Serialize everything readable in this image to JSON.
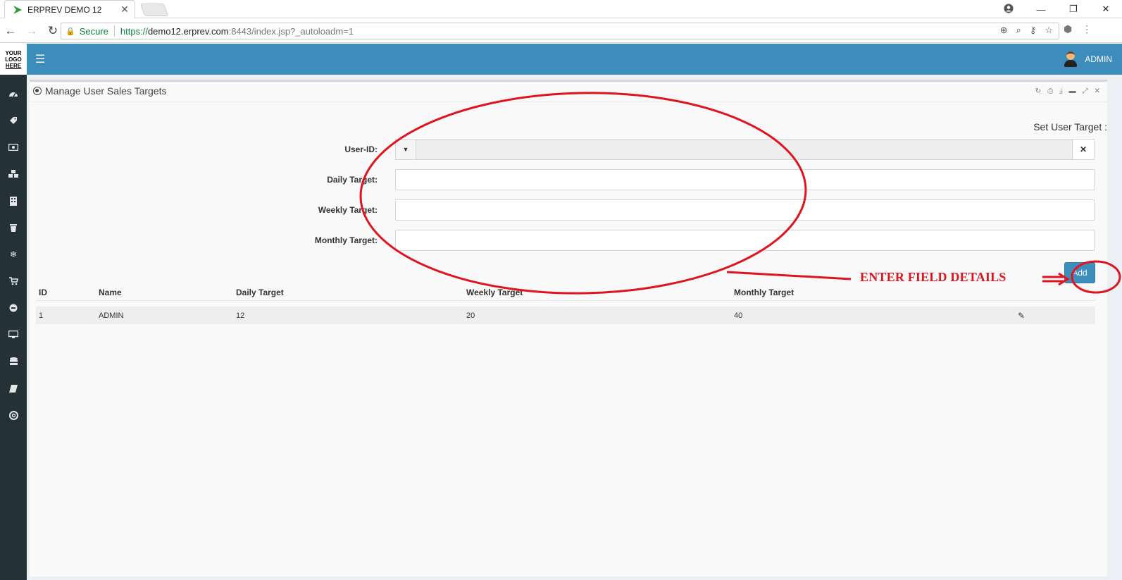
{
  "browser": {
    "tab_title": "ERPREV DEMO 12",
    "tab_close": "✕",
    "secure_label": "Secure",
    "url_scheme": "https://",
    "url_host": "demo12.erprev.com",
    "url_path": ":8443/index.jsp?_autoloadm=1",
    "window_controls": [
      "—",
      "❐",
      "✕"
    ]
  },
  "app": {
    "logo_lines": [
      "YOUR",
      "LOGO",
      "HERE"
    ],
    "user_name": "ADMIN",
    "sidebar_icons": [
      "dashboard-icon",
      "tag-icon",
      "money-icon",
      "cubes-icon",
      "building-icon",
      "trash-icon",
      "snowflake-icon",
      "cart-icon",
      "circle-icon",
      "monitor-icon",
      "database-icon",
      "book-icon",
      "lifebuoy-icon"
    ]
  },
  "panel": {
    "title": "Manage User Sales Targets",
    "set_target_label": "Set User Target :",
    "tools": [
      "refresh-icon",
      "print-icon",
      "download-icon",
      "minimize-icon",
      "expand-icon",
      "close-icon"
    ]
  },
  "form": {
    "user_id_label": "User-ID:",
    "daily_label": "Daily Target:",
    "weekly_label": "Weekly Target:",
    "monthly_label": "Monthly Target:",
    "daily_value": "",
    "weekly_value": "",
    "monthly_value": "",
    "add_label": "Add"
  },
  "table": {
    "headers": [
      "ID",
      "Name",
      "Daily Target",
      "Weekly Target",
      "Monthly Target"
    ],
    "rows": [
      {
        "id": "1",
        "name": "ADMIN",
        "daily": "12",
        "weekly": "20",
        "monthly": "40"
      }
    ]
  },
  "annotation": {
    "text": "ENTER FIELD DETAILS",
    "color": "#e0141e"
  }
}
